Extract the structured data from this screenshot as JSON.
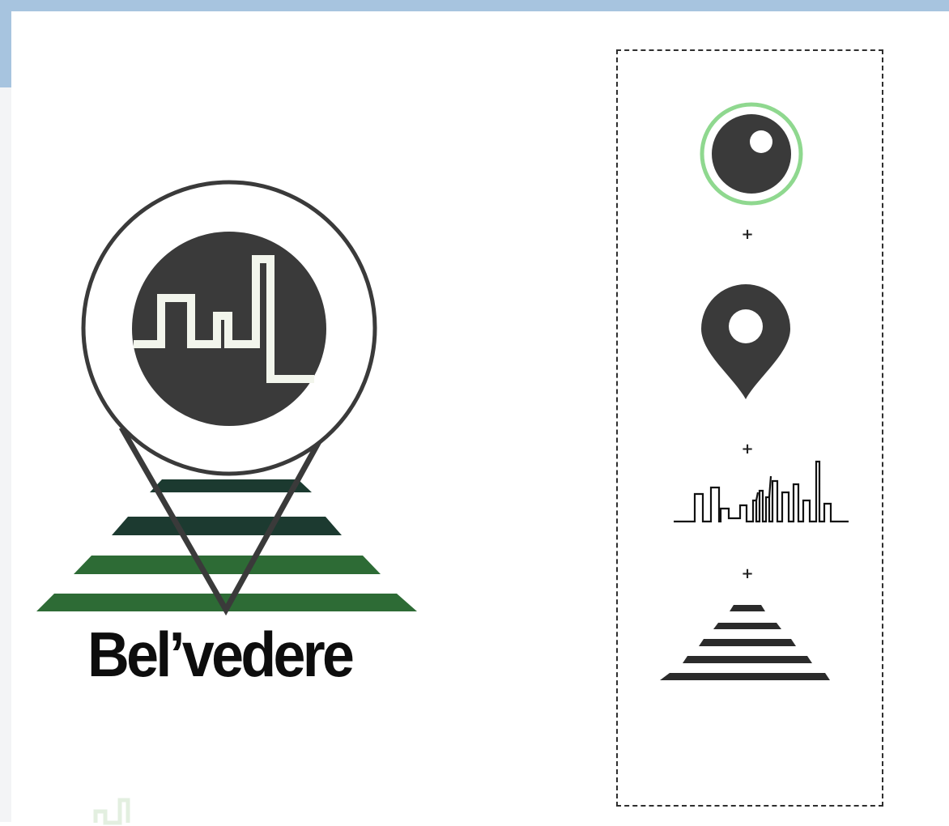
{
  "logo": {
    "brand_name": "Bel’vedere"
  },
  "legend": {
    "separators": [
      "+",
      "+",
      "+"
    ],
    "icons": [
      "eye-icon",
      "map-pin-icon",
      "city-skyline-icon",
      "striped-pyramid-icon"
    ]
  },
  "colors": {
    "top_bar": "#a7c4df",
    "left_strip": "#f3f4f6",
    "icon_dark": "#3a3a3a",
    "ring_green": "#8fd88f",
    "stripe_green": "#2d6b35",
    "stripe_dark_green": "#1c3a30",
    "line_light": "#f2f5ec"
  }
}
